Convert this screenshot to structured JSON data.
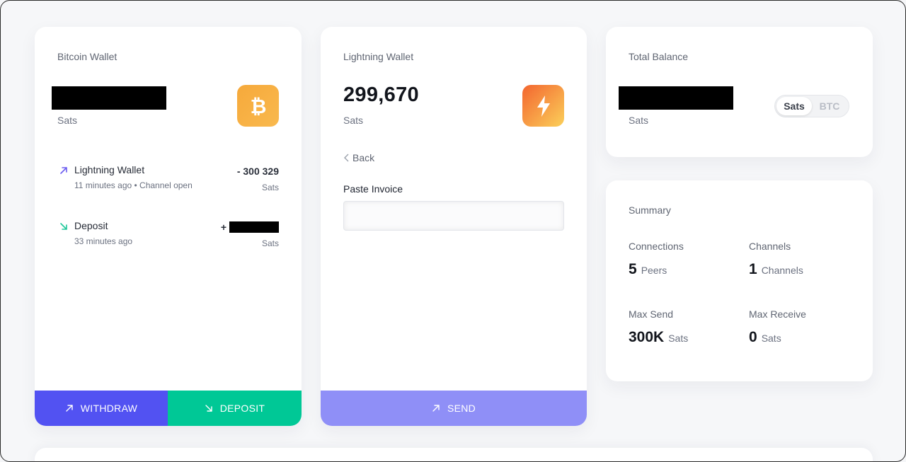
{
  "bitcoin_wallet": {
    "title": "Bitcoin Wallet",
    "unit": "Sats",
    "icon": "bitcoin-icon",
    "transactions": [
      {
        "name": "Lightning Wallet",
        "meta": "11 minutes ago • Channel open",
        "amount": "- 300 329",
        "unit": "Sats",
        "direction": "outgoing",
        "arrow_color": "#6b5cf0"
      },
      {
        "name": "Deposit",
        "meta": "33 minutes ago",
        "amount_prefix": "+",
        "unit": "Sats",
        "direction": "incoming",
        "arrow_color": "#1fc79a"
      }
    ],
    "withdraw_label": "WITHDRAW",
    "deposit_label": "DEPOSIT",
    "withdraw_color": "#5252f2",
    "deposit_color": "#00c896"
  },
  "lightning_wallet": {
    "title": "Lightning Wallet",
    "balance": "299,670",
    "unit": "Sats",
    "icon": "lightning-icon",
    "back_label": "Back",
    "invoice_label": "Paste Invoice",
    "invoice_value": "",
    "send_label": "SEND",
    "send_color": "#8f8ff7"
  },
  "total_balance": {
    "title": "Total Balance",
    "unit": "Sats",
    "toggle": {
      "options": [
        "Sats",
        "BTC"
      ],
      "selected": "Sats"
    }
  },
  "summary": {
    "title": "Summary",
    "connections": {
      "label": "Connections",
      "value": "5",
      "unit": "Peers"
    },
    "channels": {
      "label": "Channels",
      "value": "1",
      "unit": "Channels"
    },
    "max_send": {
      "label": "Max Send",
      "value": "300K",
      "unit": "Sats"
    },
    "max_receive": {
      "label": "Max Receive",
      "value": "0",
      "unit": "Sats"
    }
  }
}
